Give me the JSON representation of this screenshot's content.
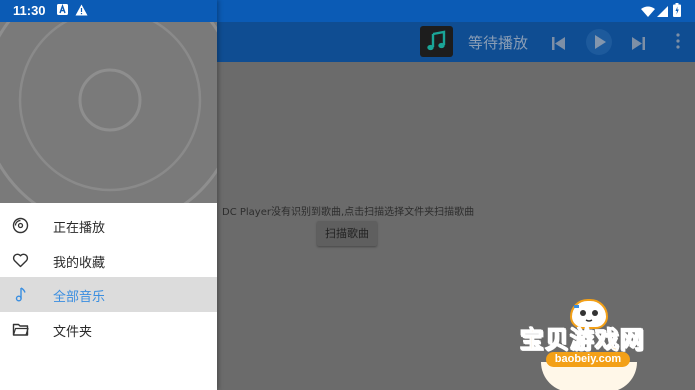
{
  "statusbar": {
    "time": "11:30"
  },
  "appbar": {
    "now_playing_title": "等待播放"
  },
  "content": {
    "empty_message": "DC Player没有识别到歌曲,点击扫描选择文件夹扫描歌曲",
    "scan_button_label": "扫描歌曲"
  },
  "drawer": {
    "items": [
      {
        "label": "正在播放",
        "icon": "disc-icon",
        "active": false
      },
      {
        "label": "我的收藏",
        "icon": "heart-icon",
        "active": false
      },
      {
        "label": "全部音乐",
        "icon": "music-note-icon",
        "active": true
      },
      {
        "label": "文件夹",
        "icon": "folder-icon",
        "active": false
      }
    ]
  },
  "watermark": {
    "text": "宝贝游戏网",
    "url": "baobeiy.com"
  },
  "colors": {
    "statusbar": "#0b5bb5",
    "appbar": "#0f4d92",
    "active_text": "#3a8ee0",
    "scrim": "#6b6b6b",
    "watermark": "#f3a017"
  }
}
